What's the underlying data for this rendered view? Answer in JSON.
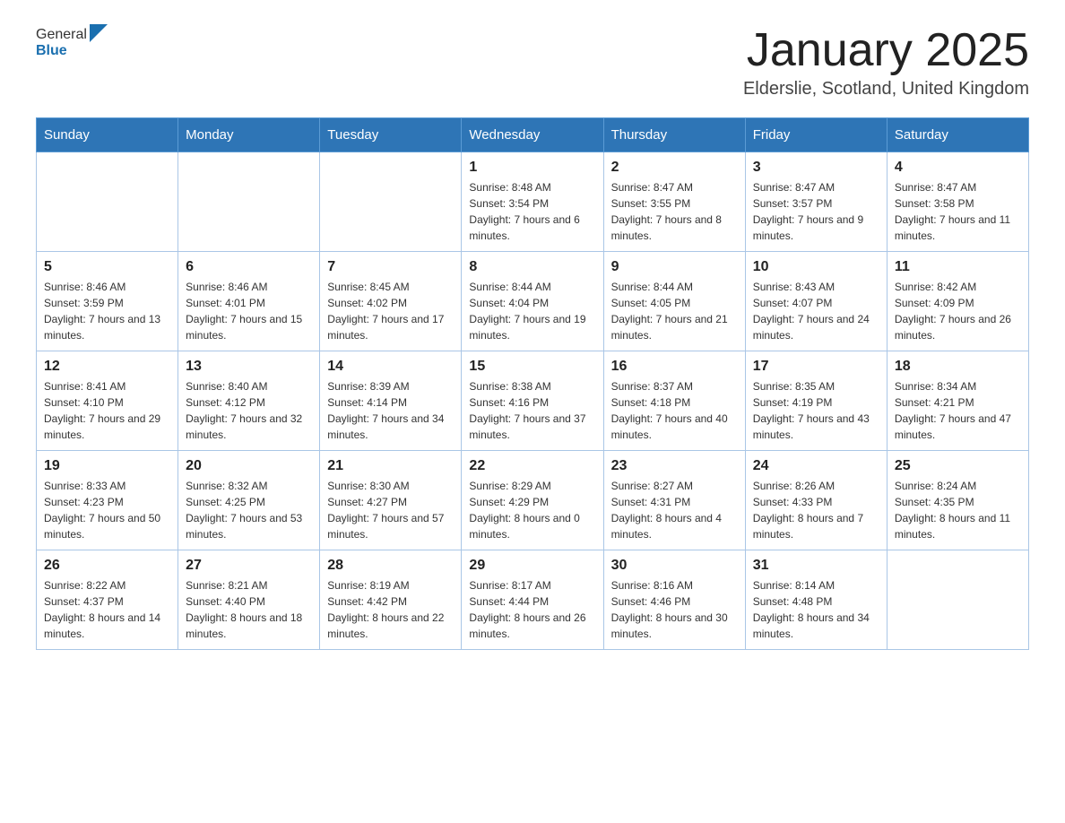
{
  "header": {
    "logo_general": "General",
    "logo_blue": "Blue",
    "month_title": "January 2025",
    "location": "Elderslie, Scotland, United Kingdom"
  },
  "days_of_week": [
    "Sunday",
    "Monday",
    "Tuesday",
    "Wednesday",
    "Thursday",
    "Friday",
    "Saturday"
  ],
  "weeks": [
    [
      {
        "day": "",
        "info": ""
      },
      {
        "day": "",
        "info": ""
      },
      {
        "day": "",
        "info": ""
      },
      {
        "day": "1",
        "info": "Sunrise: 8:48 AM\nSunset: 3:54 PM\nDaylight: 7 hours and 6 minutes."
      },
      {
        "day": "2",
        "info": "Sunrise: 8:47 AM\nSunset: 3:55 PM\nDaylight: 7 hours and 8 minutes."
      },
      {
        "day": "3",
        "info": "Sunrise: 8:47 AM\nSunset: 3:57 PM\nDaylight: 7 hours and 9 minutes."
      },
      {
        "day": "4",
        "info": "Sunrise: 8:47 AM\nSunset: 3:58 PM\nDaylight: 7 hours and 11 minutes."
      }
    ],
    [
      {
        "day": "5",
        "info": "Sunrise: 8:46 AM\nSunset: 3:59 PM\nDaylight: 7 hours and 13 minutes."
      },
      {
        "day": "6",
        "info": "Sunrise: 8:46 AM\nSunset: 4:01 PM\nDaylight: 7 hours and 15 minutes."
      },
      {
        "day": "7",
        "info": "Sunrise: 8:45 AM\nSunset: 4:02 PM\nDaylight: 7 hours and 17 minutes."
      },
      {
        "day": "8",
        "info": "Sunrise: 8:44 AM\nSunset: 4:04 PM\nDaylight: 7 hours and 19 minutes."
      },
      {
        "day": "9",
        "info": "Sunrise: 8:44 AM\nSunset: 4:05 PM\nDaylight: 7 hours and 21 minutes."
      },
      {
        "day": "10",
        "info": "Sunrise: 8:43 AM\nSunset: 4:07 PM\nDaylight: 7 hours and 24 minutes."
      },
      {
        "day": "11",
        "info": "Sunrise: 8:42 AM\nSunset: 4:09 PM\nDaylight: 7 hours and 26 minutes."
      }
    ],
    [
      {
        "day": "12",
        "info": "Sunrise: 8:41 AM\nSunset: 4:10 PM\nDaylight: 7 hours and 29 minutes."
      },
      {
        "day": "13",
        "info": "Sunrise: 8:40 AM\nSunset: 4:12 PM\nDaylight: 7 hours and 32 minutes."
      },
      {
        "day": "14",
        "info": "Sunrise: 8:39 AM\nSunset: 4:14 PM\nDaylight: 7 hours and 34 minutes."
      },
      {
        "day": "15",
        "info": "Sunrise: 8:38 AM\nSunset: 4:16 PM\nDaylight: 7 hours and 37 minutes."
      },
      {
        "day": "16",
        "info": "Sunrise: 8:37 AM\nSunset: 4:18 PM\nDaylight: 7 hours and 40 minutes."
      },
      {
        "day": "17",
        "info": "Sunrise: 8:35 AM\nSunset: 4:19 PM\nDaylight: 7 hours and 43 minutes."
      },
      {
        "day": "18",
        "info": "Sunrise: 8:34 AM\nSunset: 4:21 PM\nDaylight: 7 hours and 47 minutes."
      }
    ],
    [
      {
        "day": "19",
        "info": "Sunrise: 8:33 AM\nSunset: 4:23 PM\nDaylight: 7 hours and 50 minutes."
      },
      {
        "day": "20",
        "info": "Sunrise: 8:32 AM\nSunset: 4:25 PM\nDaylight: 7 hours and 53 minutes."
      },
      {
        "day": "21",
        "info": "Sunrise: 8:30 AM\nSunset: 4:27 PM\nDaylight: 7 hours and 57 minutes."
      },
      {
        "day": "22",
        "info": "Sunrise: 8:29 AM\nSunset: 4:29 PM\nDaylight: 8 hours and 0 minutes."
      },
      {
        "day": "23",
        "info": "Sunrise: 8:27 AM\nSunset: 4:31 PM\nDaylight: 8 hours and 4 minutes."
      },
      {
        "day": "24",
        "info": "Sunrise: 8:26 AM\nSunset: 4:33 PM\nDaylight: 8 hours and 7 minutes."
      },
      {
        "day": "25",
        "info": "Sunrise: 8:24 AM\nSunset: 4:35 PM\nDaylight: 8 hours and 11 minutes."
      }
    ],
    [
      {
        "day": "26",
        "info": "Sunrise: 8:22 AM\nSunset: 4:37 PM\nDaylight: 8 hours and 14 minutes."
      },
      {
        "day": "27",
        "info": "Sunrise: 8:21 AM\nSunset: 4:40 PM\nDaylight: 8 hours and 18 minutes."
      },
      {
        "day": "28",
        "info": "Sunrise: 8:19 AM\nSunset: 4:42 PM\nDaylight: 8 hours and 22 minutes."
      },
      {
        "day": "29",
        "info": "Sunrise: 8:17 AM\nSunset: 4:44 PM\nDaylight: 8 hours and 26 minutes."
      },
      {
        "day": "30",
        "info": "Sunrise: 8:16 AM\nSunset: 4:46 PM\nDaylight: 8 hours and 30 minutes."
      },
      {
        "day": "31",
        "info": "Sunrise: 8:14 AM\nSunset: 4:48 PM\nDaylight: 8 hours and 34 minutes."
      },
      {
        "day": "",
        "info": ""
      }
    ]
  ]
}
